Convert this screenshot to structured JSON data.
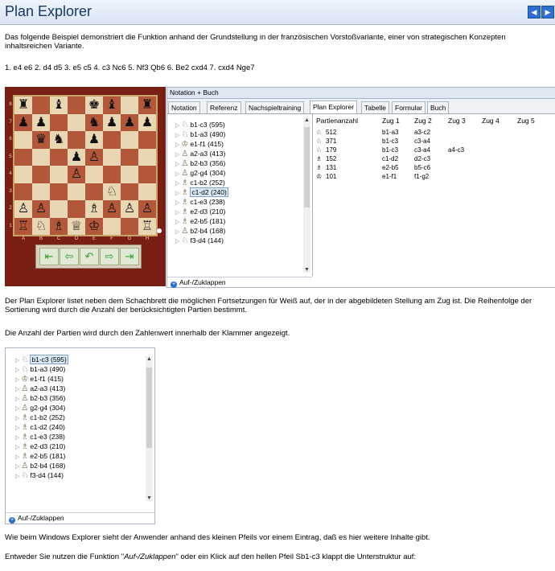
{
  "header": {
    "title": "Plan Explorer",
    "prev_icon": "arrow-left-icon",
    "next_icon": "arrow-right-icon"
  },
  "paragraphs": {
    "intro": "Das folgende Beispiel demonstriert die Funktion anhand der Grundstellung in der französischen Vorstoßvariante, einer von strategischen Konzepten inhaltsreichen Variante.",
    "moves": "1. e4 e6 2. d4 d5 3. e5 c5 4. c3 Nc6 5. Nf3 Qb6 6. Be2 cxd4 7. cxd4 Nge7",
    "p2": "Der Plan Explorer listet neben dem Schachbrett die möglichen Fortsetzungen für Weiß auf, der in der abgebildeten Stellung am Zug ist. Die Reihenfolge der Sortierung wird durch die Anzahl der berücksichtigten Partien bestimmt.",
    "p3": "Die Anzahl der Partien wird durch den Zahlenwert innerhalb der Klammer angezeigt.",
    "p4": "Wie beim Windows Explorer sieht der Anwender anhand des kleinen Pfeils vor einem Eintrag, daß es hier weitere Inhalte gibt.",
    "p5_prefix": "Entweder Sie nutzen die Funktion \"",
    "p5_em": "Auf-/Zuklappen",
    "p5_suffix": "\" oder ein Klick auf den hellen Pfeil Sb1-c3 klappt die Unterstruktur auf:"
  },
  "board": {
    "ranks": [
      "8",
      "7",
      "6",
      "5",
      "4",
      "3",
      "2",
      "1"
    ],
    "files": [
      "A",
      "B",
      "C",
      "D",
      "E",
      "F",
      "G",
      "H"
    ],
    "pieces": [
      {
        "r": 0,
        "f": 0,
        "p": "♜"
      },
      {
        "r": 0,
        "f": 2,
        "p": "♝"
      },
      {
        "r": 0,
        "f": 4,
        "p": "♚"
      },
      {
        "r": 0,
        "f": 5,
        "p": "♝"
      },
      {
        "r": 0,
        "f": 7,
        "p": "♜"
      },
      {
        "r": 1,
        "f": 0,
        "p": "♟"
      },
      {
        "r": 1,
        "f": 1,
        "p": "♟"
      },
      {
        "r": 1,
        "f": 4,
        "p": "♞"
      },
      {
        "r": 1,
        "f": 5,
        "p": "♟"
      },
      {
        "r": 1,
        "f": 6,
        "p": "♟"
      },
      {
        "r": 1,
        "f": 7,
        "p": "♟"
      },
      {
        "r": 2,
        "f": 1,
        "p": "♛"
      },
      {
        "r": 2,
        "f": 2,
        "p": "♞"
      },
      {
        "r": 2,
        "f": 4,
        "p": "♟"
      },
      {
        "r": 3,
        "f": 3,
        "p": "♟"
      },
      {
        "r": 3,
        "f": 4,
        "p": "♙"
      },
      {
        "r": 4,
        "f": 3,
        "p": "♙"
      },
      {
        "r": 5,
        "f": 5,
        "p": "♘"
      },
      {
        "r": 6,
        "f": 0,
        "p": "♙"
      },
      {
        "r": 6,
        "f": 1,
        "p": "♙"
      },
      {
        "r": 6,
        "f": 4,
        "p": "♗"
      },
      {
        "r": 6,
        "f": 5,
        "p": "♙"
      },
      {
        "r": 6,
        "f": 6,
        "p": "♙"
      },
      {
        "r": 6,
        "f": 7,
        "p": "♙"
      },
      {
        "r": 7,
        "f": 0,
        "p": "♖"
      },
      {
        "r": 7,
        "f": 1,
        "p": "♘"
      },
      {
        "r": 7,
        "f": 2,
        "p": "♗"
      },
      {
        "r": 7,
        "f": 3,
        "p": "♕"
      },
      {
        "r": 7,
        "f": 4,
        "p": "♔"
      },
      {
        "r": 7,
        "f": 7,
        "p": "♖"
      }
    ],
    "nav_icons": [
      "first-move-icon",
      "back-icon",
      "undo-icon",
      "forward-icon",
      "last-move-icon"
    ]
  },
  "panel": {
    "title": "Notation + Buch",
    "tabs": [
      "Notation",
      "Referenz",
      "Nachspieltraining",
      "Plan Explorer",
      "Tabelle",
      "Formular",
      "Buch"
    ],
    "active_tab": "Plan Explorer",
    "tree": [
      {
        "piece": "knight",
        "label": "b1-c3 (595)"
      },
      {
        "piece": "knight",
        "label": "b1-a3 (490)"
      },
      {
        "piece": "king",
        "label": "e1-f1 (415)"
      },
      {
        "piece": "pawn",
        "label": "a2-a3 (413)"
      },
      {
        "piece": "pawn",
        "label": "b2-b3 (356)"
      },
      {
        "piece": "pawn",
        "label": "g2-g4 (304)"
      },
      {
        "piece": "bishop",
        "label": "c1-b2 (252)"
      },
      {
        "piece": "bishop",
        "label": "c1-d2 (240)",
        "selected": true
      },
      {
        "piece": "bishop",
        "label": "c1-e3 (238)"
      },
      {
        "piece": "bishop",
        "label": "e2-d3 (210)"
      },
      {
        "piece": "bishop",
        "label": "e2-b5 (181)"
      },
      {
        "piece": "pawn",
        "label": "b2-b4 (168)"
      },
      {
        "piece": "knight",
        "label": "f3-d4 (144)"
      }
    ],
    "collapse_label": "Auf-/Zuklappen",
    "table": {
      "headers": [
        "Partienanzahl",
        "Zug 1",
        "Zug 2",
        "Zug 3",
        "Zug 4",
        "Zug 5"
      ],
      "rows": [
        [
          "512",
          "b1-a3",
          "a3-c2",
          "",
          "",
          ""
        ],
        [
          "371",
          "b1-c3",
          "c3-a4",
          "",
          "",
          ""
        ],
        [
          "179",
          "b1-c3",
          "c3-a4",
          "a4-c3",
          "",
          ""
        ],
        [
          "152",
          "c1-d2",
          "d2-c3",
          "",
          "",
          ""
        ],
        [
          "131",
          "e2-b5",
          "b5-c6",
          "",
          "",
          ""
        ],
        [
          "101",
          "e1-f1",
          "f1-g2",
          "",
          "",
          ""
        ]
      ],
      "row_pieces": [
        "knight",
        "knight",
        "knight",
        "bishop",
        "bishop",
        "king"
      ]
    }
  },
  "tree2": {
    "items": [
      {
        "piece": "knight",
        "label": "b1-c3 (595)",
        "selected": true
      },
      {
        "piece": "knight",
        "label": "b1-a3 (490)"
      },
      {
        "piece": "king",
        "label": "e1-f1 (415)"
      },
      {
        "piece": "pawn",
        "label": "a2-a3 (413)"
      },
      {
        "piece": "pawn",
        "label": "b2-b3 (356)"
      },
      {
        "piece": "pawn",
        "label": "g2-g4 (304)"
      },
      {
        "piece": "bishop",
        "label": "c1-b2 (252)"
      },
      {
        "piece": "bishop",
        "label": "c1-d2 (240)"
      },
      {
        "piece": "bishop",
        "label": "c1-e3 (238)"
      },
      {
        "piece": "bishop",
        "label": "e2-d3 (210)"
      },
      {
        "piece": "bishop",
        "label": "e2-b5 (181)"
      },
      {
        "piece": "pawn",
        "label": "b2-b4 (168)"
      },
      {
        "piece": "knight",
        "label": "f3-d4 (144)"
      }
    ],
    "collapse_label": "Auf-/Zuklappen"
  }
}
